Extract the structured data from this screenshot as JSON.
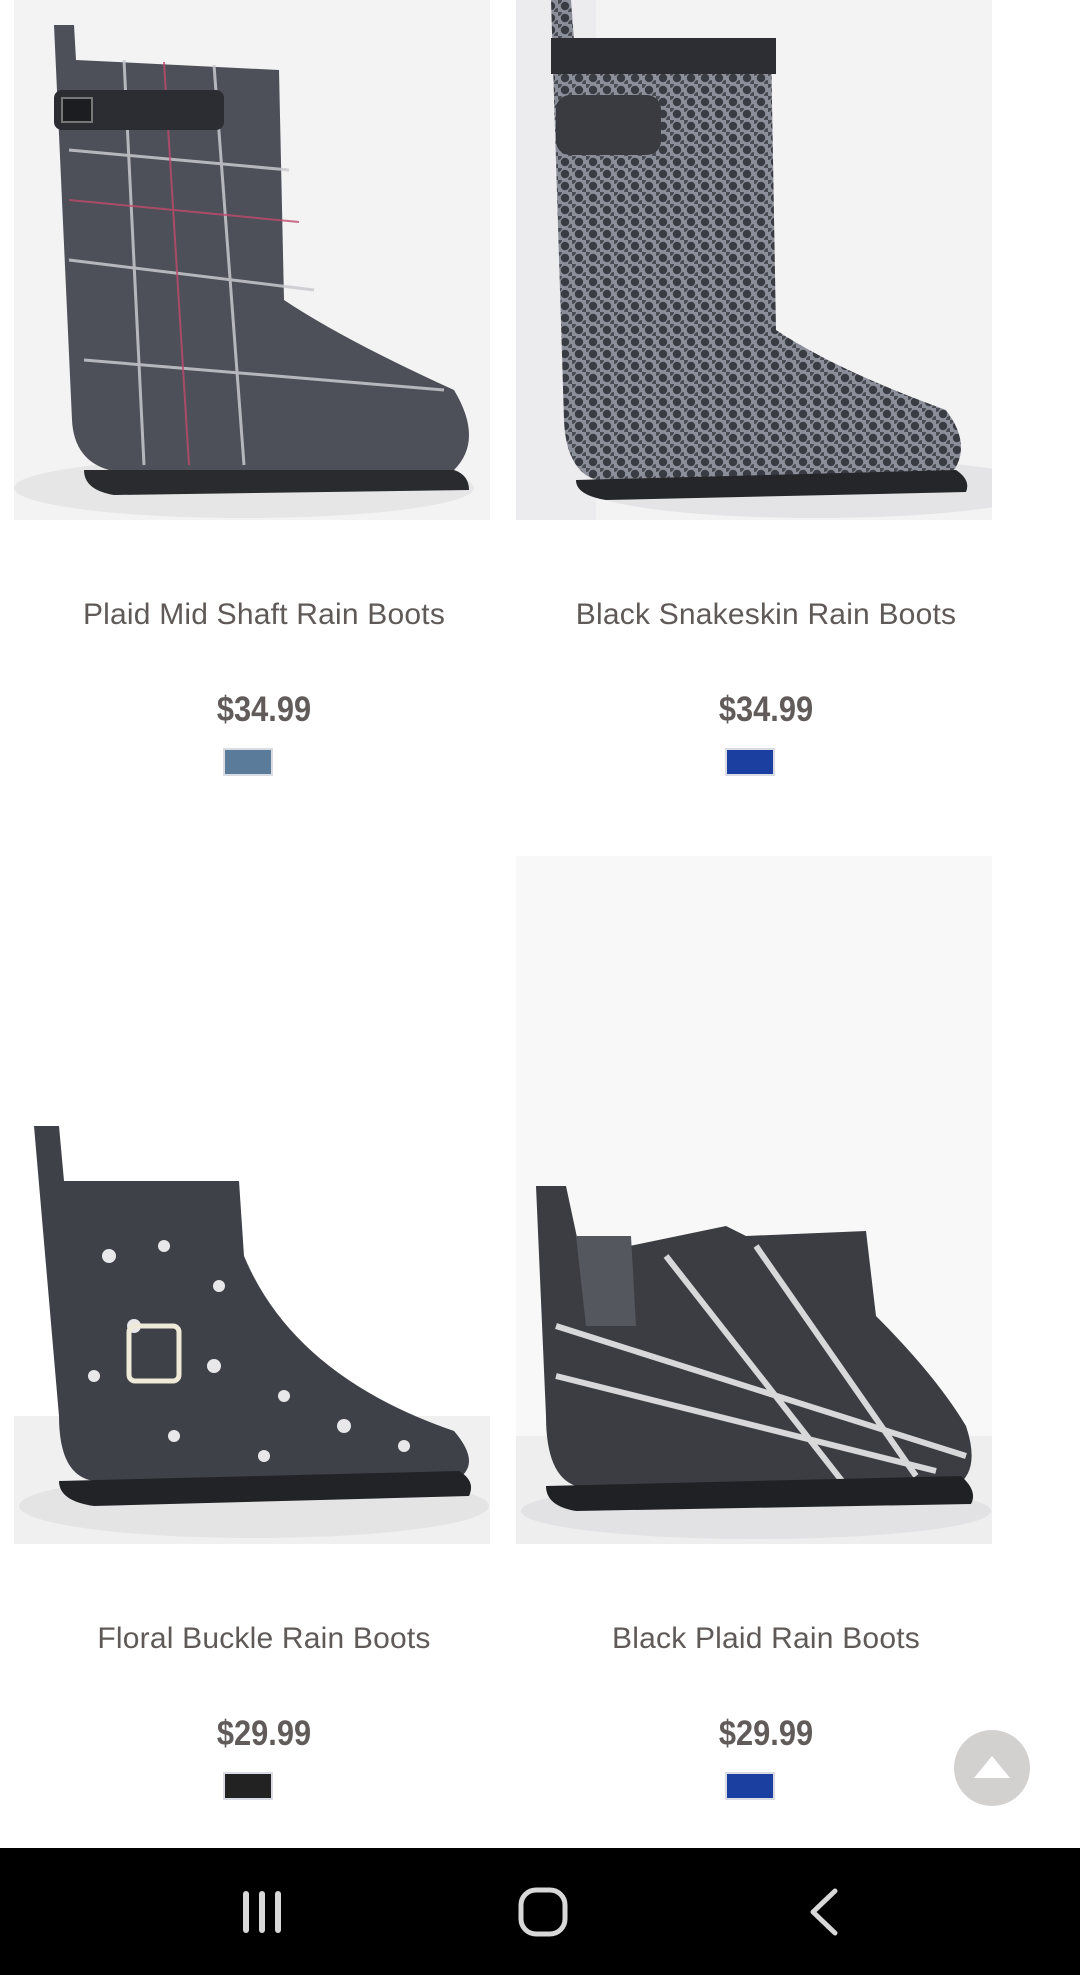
{
  "products": [
    {
      "name": "Plaid Mid Shaft Rain Boots",
      "price": "$34.99",
      "swatch_color": "#5b7b9b",
      "image": "plaid-mid-shaft-boot-image"
    },
    {
      "name": "Black Snakeskin Rain Boots",
      "price": "$34.99",
      "swatch_color": "#1b3fa1",
      "image": "snakeskin-boot-image"
    },
    {
      "name": "Floral Buckle Rain Boots",
      "price": "$29.99",
      "swatch_color": "#222222",
      "image": "floral-buckle-boot-image"
    },
    {
      "name": "Black Plaid Rain Boots",
      "price": "$29.99",
      "swatch_color": "#1b3fa1",
      "image": "black-plaid-boot-image"
    }
  ],
  "scroll_top": {
    "icon": "triangle-up-icon"
  },
  "system_nav": {
    "recents": "recents-icon",
    "home": "home-icon",
    "back": "back-icon"
  }
}
